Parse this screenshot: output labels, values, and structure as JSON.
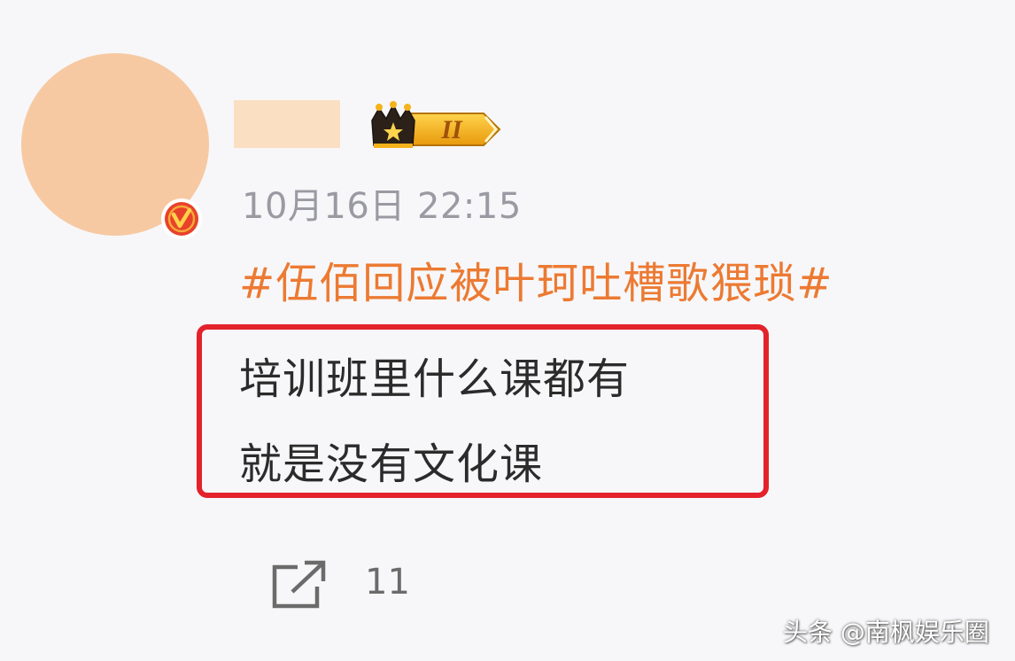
{
  "post": {
    "timestamp": "10月16日 22:15",
    "hashtag": "#伍佰回应被叶珂吐槽歌猥琐#",
    "lines": [
      "培训班里什么课都有",
      "就是没有文化课"
    ]
  },
  "rank_badge": {
    "level": "II"
  },
  "actions": {
    "share_count": "11"
  },
  "watermark": {
    "text": "头条 @南枫娱乐圈"
  },
  "icons": {
    "verified": "verified-v-icon",
    "crown": "crown-icon",
    "share": "share-icon"
  },
  "colors": {
    "background": "#f7f7f9",
    "hashtag": "#ec7a32",
    "highlight_border": "#e3222b",
    "body_text": "#2b2b2b",
    "timestamp": "#9a9aa3",
    "avatar_blur": "#f7c9a2",
    "name_blur": "#fbdfc3",
    "badge_gold": "#f5b21a"
  }
}
